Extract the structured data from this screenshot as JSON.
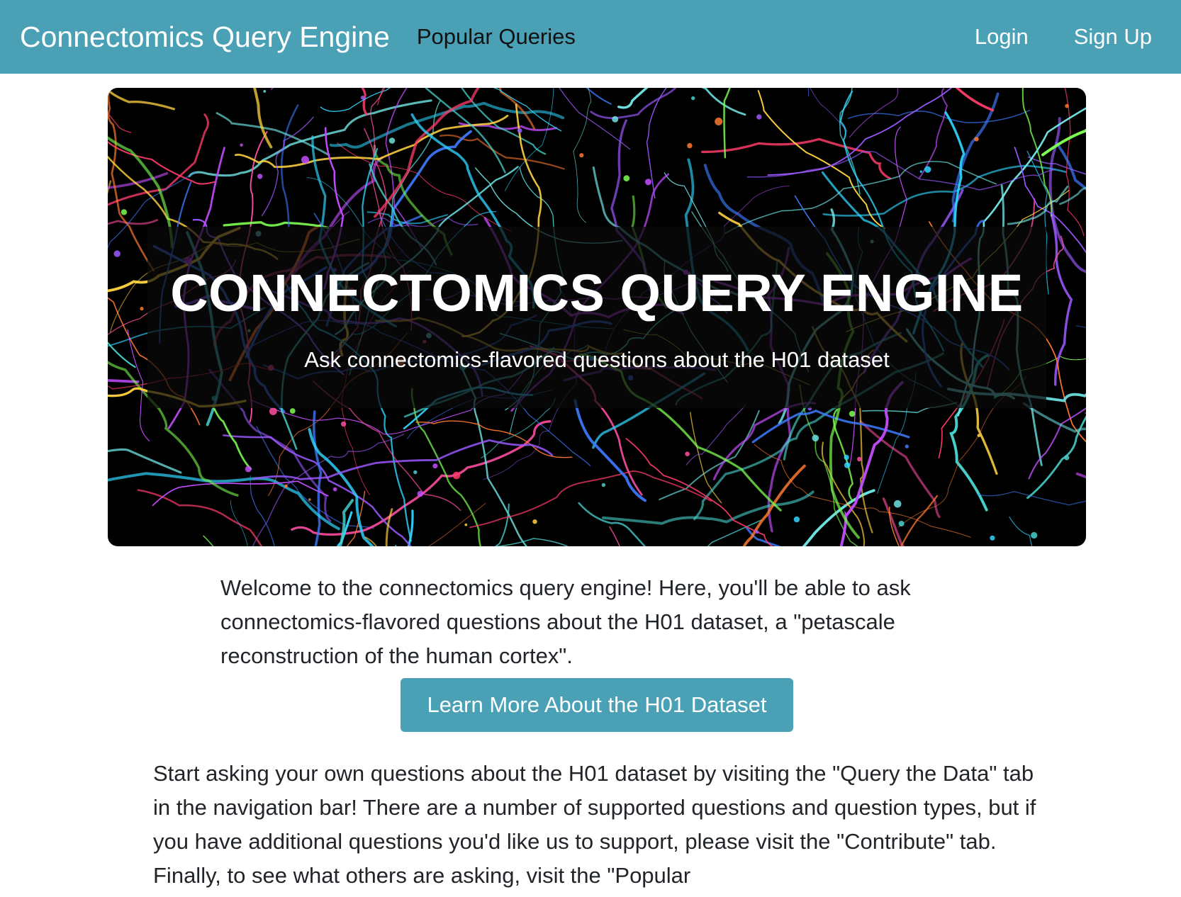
{
  "navbar": {
    "brand": "Connectomics Query Engine",
    "links": [
      "Popular Queries"
    ],
    "login": "Login",
    "signup": "Sign Up"
  },
  "hero": {
    "title": "CONNECTOMICS QUERY ENGINE",
    "subtitle": "Ask connectomics-flavored questions about the H01 dataset"
  },
  "main": {
    "welcome_text": "Welcome to the connectomics query engine! Here, you'll be able to ask connectomics-flavored questions about the H01 dataset, a \"petascale reconstruction of the human cortex\".",
    "learn_more_button": "Learn More About the H01 Dataset",
    "start_text": "Start asking your own questions about the H01 dataset by visiting the \"Query the Data\" tab in the navigation bar! There are a number of supported questions and question types, but if you have additional questions you'd like us to support, please visit the \"Contribute\" tab. Finally, to see what others are asking, visit the \"Popular"
  },
  "colors": {
    "navbar": "#4aa0b5",
    "button": "#4aa0b5",
    "text": "#212529"
  }
}
